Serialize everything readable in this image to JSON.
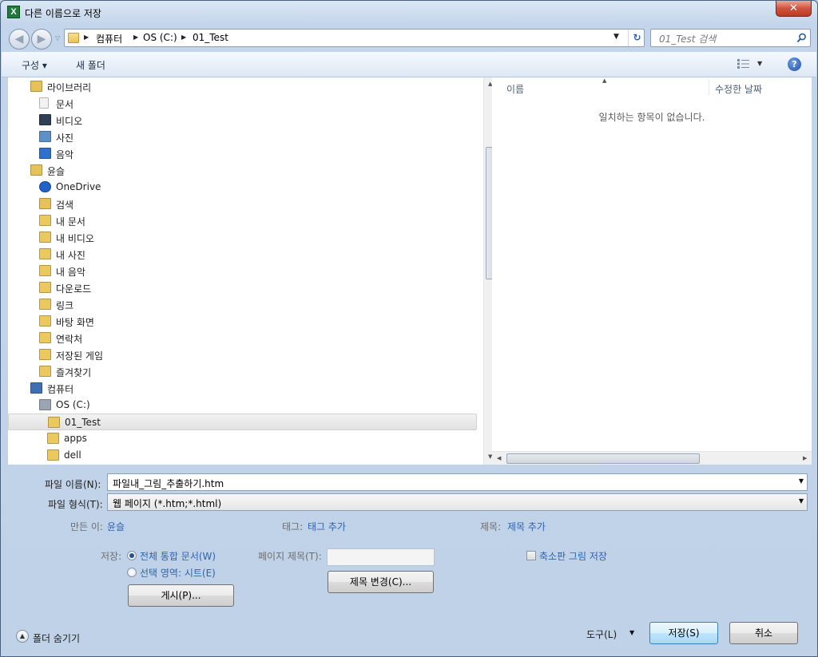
{
  "window": {
    "title": "다른 이름으로 저장",
    "close_label": "✕"
  },
  "address": {
    "crumbs": [
      "컴퓨터",
      "OS (C:)",
      "01_Test"
    ],
    "search_placeholder": "01_Test 검색"
  },
  "toolbar": {
    "organize": "구성 ▾",
    "new_folder": "새 폴더",
    "help": "?"
  },
  "tree": [
    {
      "label": "라이브러리",
      "icon": "library-icon",
      "indent": 1
    },
    {
      "label": "문서",
      "icon": "document-icon",
      "indent": 2
    },
    {
      "label": "비디오",
      "icon": "video-icon",
      "indent": 2
    },
    {
      "label": "사진",
      "icon": "picture-icon",
      "indent": 2
    },
    {
      "label": "음악",
      "icon": "music-icon",
      "indent": 2
    },
    {
      "label": "윤슬",
      "icon": "user-folder-icon",
      "indent": 1
    },
    {
      "label": "OneDrive",
      "icon": "cloud-icon",
      "indent": 2
    },
    {
      "label": "검색",
      "icon": "search-folder-icon",
      "indent": 2
    },
    {
      "label": "내 문서",
      "icon": "folder-icon",
      "indent": 2
    },
    {
      "label": "내 비디오",
      "icon": "folder-icon",
      "indent": 2
    },
    {
      "label": "내 사진",
      "icon": "folder-icon",
      "indent": 2
    },
    {
      "label": "내 음악",
      "icon": "folder-icon",
      "indent": 2
    },
    {
      "label": "다운로드",
      "icon": "download-folder-icon",
      "indent": 2
    },
    {
      "label": "링크",
      "icon": "folder-icon",
      "indent": 2
    },
    {
      "label": "바탕 화면",
      "icon": "desktop-folder-icon",
      "indent": 2
    },
    {
      "label": "연락처",
      "icon": "contacts-folder-icon",
      "indent": 2
    },
    {
      "label": "저장된 게임",
      "icon": "games-folder-icon",
      "indent": 2
    },
    {
      "label": "즐겨찾기",
      "icon": "favorites-folder-icon",
      "indent": 2
    },
    {
      "label": "컴퓨터",
      "icon": "computer-icon",
      "indent": 1
    },
    {
      "label": "OS (C:)",
      "icon": "drive-icon",
      "indent": 2
    },
    {
      "label": "01_Test",
      "icon": "folder-icon",
      "indent": 3,
      "selected": true
    },
    {
      "label": "apps",
      "icon": "folder-icon",
      "indent": 3
    },
    {
      "label": "dell",
      "icon": "folder-icon",
      "indent": 3
    }
  ],
  "list": {
    "col_name": "이름",
    "col_modified": "수정한 날짜",
    "empty": "일치하는 항목이 없습니다."
  },
  "form": {
    "filename_label": "파일 이름(N):",
    "filename_value": "파일내_그림_추출하기.htm",
    "filetype_label": "파일 형식(T):",
    "filetype_value": "웹 페이지 (*.htm;*.html)",
    "author_label": "만든 이:",
    "author_value": "윤슬",
    "tags_label": "태그:",
    "tags_value": "태그 추가",
    "title_label": "제목:",
    "title_value": "제목 추가",
    "save_label": "저장:",
    "radio_whole": "전체 통합 문서(W)",
    "radio_selection": "선택 영역: 시트(E)",
    "publish_button": "게시(P)...",
    "page_title_label": "페이지 제목(T):",
    "change_title_button": "제목 변경(C)...",
    "thumbnail_label": "축소판 그림 저장"
  },
  "footer": {
    "hide_folders": "폴더 숨기기",
    "tools": "도구(L)",
    "save": "저장(S)",
    "cancel": "취소"
  }
}
